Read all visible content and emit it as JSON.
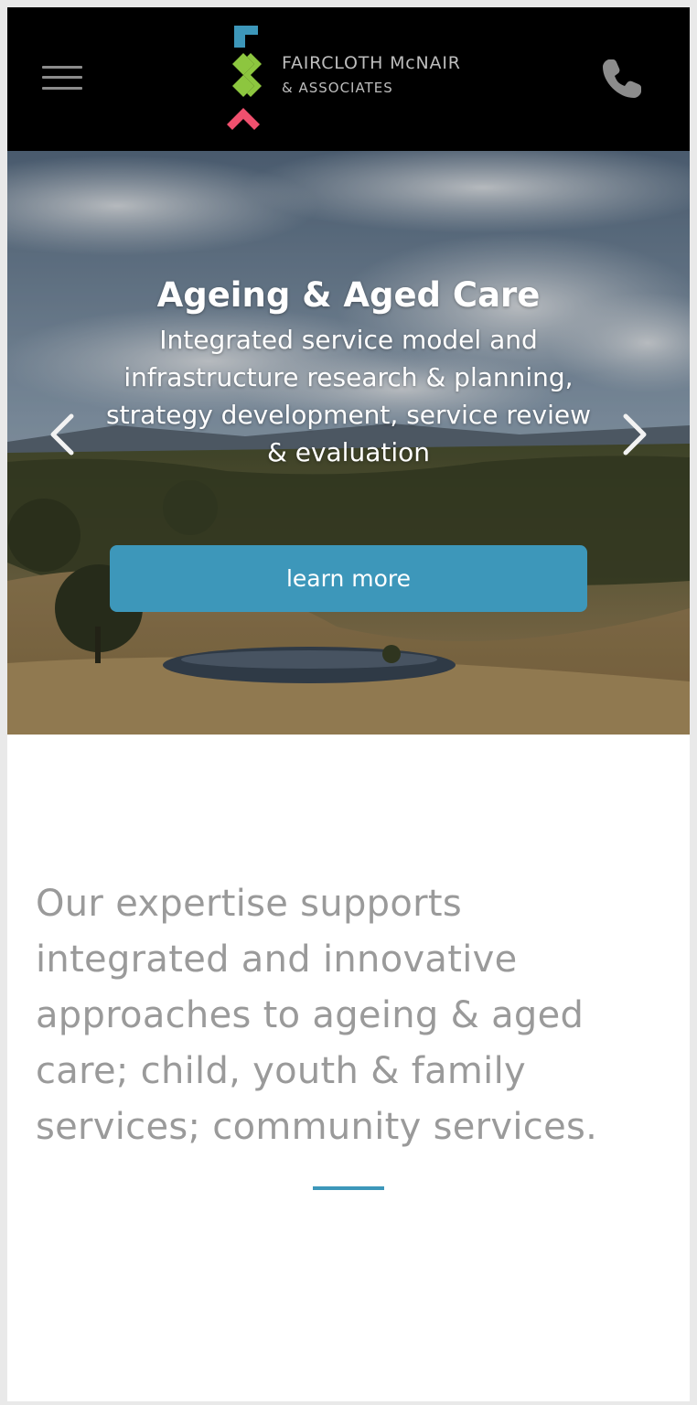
{
  "header": {
    "brand_line1": "FAIRCLOTH McNAIR",
    "brand_line2": "& ASSOCIATES",
    "icons": {
      "menu": "hamburger-menu-icon",
      "phone": "phone-icon"
    },
    "logo_colors": [
      "#3d97ba",
      "#8dc63f",
      "#f0506e"
    ]
  },
  "hero": {
    "title": "Ageing & Aged Care",
    "subtitle": "Integrated service model and infrastructure research & planning, strategy development, service review & evaluation",
    "button_label": "learn more",
    "prev_icon": "chevron-left-icon",
    "next_icon": "chevron-right-icon"
  },
  "intro": {
    "text": "Our expertise supports integrated and innovative approaches to ageing & aged care; child, youth & family services; community services."
  },
  "colors": {
    "accent": "#3d97ba",
    "header_bg": "#000000",
    "intro_text": "#9a9a9a"
  }
}
